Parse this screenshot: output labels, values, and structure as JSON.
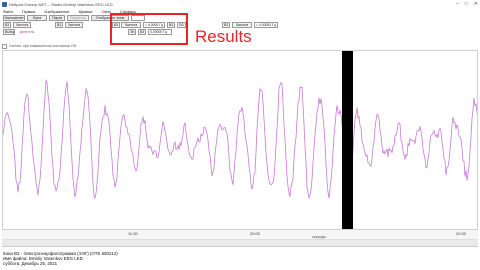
{
  "titlebar": {
    "title": "Нейрон-Спектр.NET – Studio Dmitriy Vasenkov EEG LED"
  },
  "menu": [
    "Файл",
    "Правка",
    "Изображение",
    "Кривые",
    "Окно",
    "Справка"
  ],
  "toolbar": {
    "b1": "Наложение",
    "b2": "Лупа",
    "b3": "Пауза",
    "b4": "Разметка",
    "b5": "Отобразить зоны"
  },
  "controls": {
    "ch1": "B3",
    "ch1_mode": "Частота",
    "ch1_value": "= 4.0000 Гц",
    "ch2": "B3",
    "ch2_value": "0.01000 Гц",
    "ch_x": "B3",
    "small_a": "Эп.",
    "small_b": "B3",
    "result_readout": "0.00000 Гц",
    "r1": "B3",
    "r1_mode": "Частота",
    "r1_value": "= 4.00000 Гц",
    "left_a": "B3",
    "left_b": "Частота",
    "left_c": "B3",
    "left_d": "Частота",
    "left_e": "Выбор",
    "left_f": "делитель"
  },
  "annotation": {
    "label": "Results"
  },
  "statusline": {
    "text": "Сигнал: при повышенном состоянии ОФ"
  },
  "time_axis": {
    "ticks": [
      "11:30",
      "20:00",
      "20:30"
    ],
    "unit": "секунды"
  },
  "info": {
    "line1": "Кана B3 - Электроэнцефалограмма (ЭЭГ) (ОТЕ 650212)",
    "line2": "Имя файла: Dmitriy Vasenkov EEG LED",
    "line3": "суббота, Декабрь 25, 2021"
  },
  "colors": {
    "trace": "#c77bd6",
    "marker": "#000000",
    "accent": "#e8242a"
  }
}
